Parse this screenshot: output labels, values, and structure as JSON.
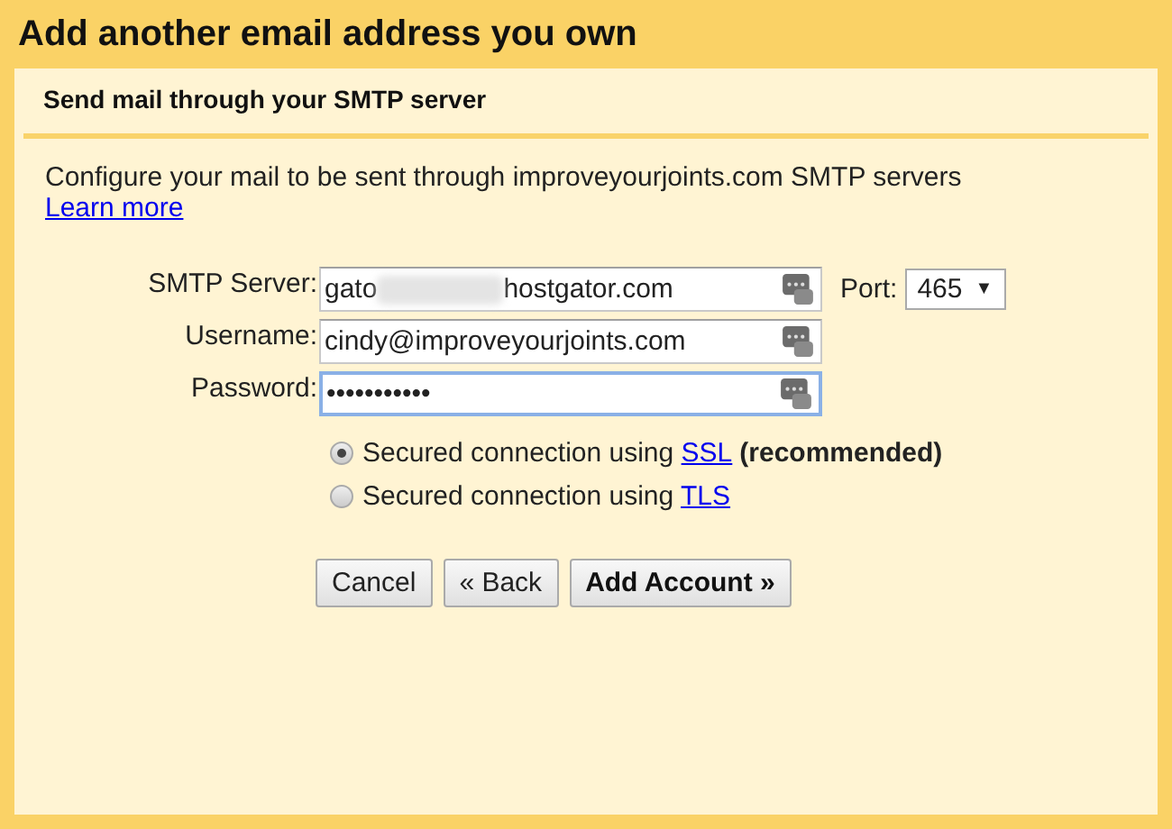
{
  "window": {
    "title": "Add another email address you own"
  },
  "section": {
    "title": "Send mail through your SMTP server"
  },
  "intro": {
    "text": "Configure your mail to be sent through improveyourjoints.com SMTP servers",
    "link": "Learn more"
  },
  "fields": [
    {
      "label": "SMTP Server:",
      "value": "gato",
      "value_end": "hostgator.com",
      "redacted": true,
      "focused": false
    },
    {
      "label": "Username:",
      "value": "cindy@improveyourjoints.com",
      "redacted": false,
      "focused": false
    },
    {
      "label": "Password:",
      "value": "•••••••••••",
      "redacted": false,
      "focused": true
    }
  ],
  "port": {
    "label": "Port:",
    "value": "465",
    "caret": "▼"
  },
  "security": [
    {
      "prefix": "Secured connection using",
      "link": "SSL",
      "note": "(recommended)",
      "selected": true
    },
    {
      "prefix": "Secured connection using",
      "link": "TLS",
      "selected": false
    }
  ],
  "buttons": [
    {
      "label": "Cancel",
      "primary": false
    },
    {
      "label": "« Back",
      "primary": false
    },
    {
      "label": "Add Account »",
      "primary": true
    }
  ]
}
